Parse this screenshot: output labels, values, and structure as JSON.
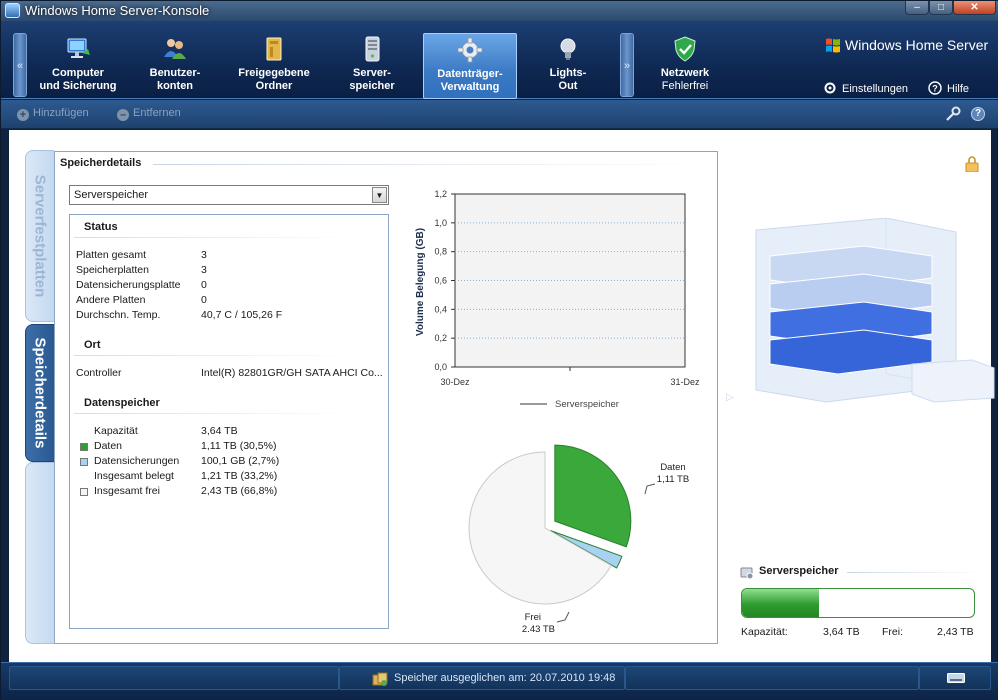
{
  "window": {
    "title": "Windows Home Server-Konsole",
    "min": "–",
    "max": "□",
    "close": "✕"
  },
  "nav": {
    "scroll_left": "«",
    "scroll_right": "»",
    "tabs": [
      {
        "line1": "Computer",
        "line2": "und Sicherung",
        "icon": "computer-icon"
      },
      {
        "line1": "Benutzer-",
        "line2": "konten",
        "icon": "users-icon"
      },
      {
        "line1": "Freigegebene",
        "line2": "Ordner",
        "icon": "folder-icon"
      },
      {
        "line1": "Server-",
        "line2": "speicher",
        "icon": "server-storage-icon"
      },
      {
        "line1": "Datenträger-",
        "line2": "Verwaltung",
        "icon": "gear-icon"
      },
      {
        "line1": "Lights-",
        "line2": "Out",
        "icon": "lightbulb-icon"
      }
    ],
    "network": {
      "line1": "Netzwerk",
      "line2": "Fehlerfrei",
      "icon": "shield-check-icon"
    },
    "brand": "Windows Home Server",
    "settings": "Einstellungen",
    "help": "Hilfe"
  },
  "actions": {
    "add": "Hinzufügen",
    "remove": "Entfernen"
  },
  "sidetabs": {
    "tab1": "Serverfestplatten",
    "tab2": "Speicherdetails"
  },
  "panel": {
    "title": "Speicherdetails",
    "dropdown": {
      "selected": "Serverspeicher"
    },
    "status": {
      "title": "Status",
      "rows": [
        {
          "label": "Platten gesamt",
          "value": "3"
        },
        {
          "label": "Speicherplatten",
          "value": "3"
        },
        {
          "label": "Datensicherungsplatte",
          "value": "0"
        },
        {
          "label": "Andere Platten",
          "value": "0"
        },
        {
          "label": "Durchschn. Temp.",
          "value": "40,7 C / 105,26 F"
        }
      ]
    },
    "ort": {
      "title": "Ort",
      "rows": [
        {
          "label": "Controller",
          "value": "Intel(R) 82801GR/GH SATA AHCI Co..."
        }
      ]
    },
    "storage": {
      "title": "Datenspeicher",
      "rows": [
        {
          "label": "Kapazität",
          "value": "3,64 TB",
          "swatch": ""
        },
        {
          "label": "Daten",
          "value": "1,11 TB (30,5%)",
          "swatch": "#2f9f2f"
        },
        {
          "label": "Datensicherungen",
          "value": "100,1 GB (2,7%)",
          "swatch": "#a8d2f2"
        },
        {
          "label": "Insgesamt belegt",
          "value": "1,21 TB (33,2%)",
          "swatch": ""
        },
        {
          "label": "Insgesamt frei",
          "value": "2,43 TB (66,8%)",
          "swatch": "#f4f4f4"
        }
      ]
    }
  },
  "chart_data": [
    {
      "type": "line",
      "ylabel": "Volume Belegung (GB)",
      "ylim": [
        0,
        1.2
      ],
      "yticks": [
        "0,0",
        "0,2",
        "0,4",
        "0,6",
        "0,8",
        "1,0",
        "1,2"
      ],
      "x": [
        "30-Dez",
        "31-Dez"
      ],
      "series": [
        {
          "name": "Serverspeicher",
          "values": []
        }
      ],
      "grid": true,
      "legend": "bottom"
    },
    {
      "type": "pie",
      "slices": [
        {
          "label": "Daten",
          "value_label": "1,11 TB",
          "percent": 30.5,
          "color": "#3aa83a"
        },
        {
          "label": "Datensicherungen",
          "value_label": "",
          "percent": 2.7,
          "color": "#a8d2f2"
        },
        {
          "label": "Frei",
          "value_label": "2,43 TB",
          "percent": 66.8,
          "color": "#f6f6f6"
        }
      ]
    }
  ],
  "server_storage": {
    "title": "Serverspeicher",
    "used_fraction": 0.332,
    "capacity_label": "Kapazität:",
    "capacity": "3,64 TB",
    "free_label": "Frei:",
    "free": "2,43 TB"
  },
  "status_bar": {
    "text": "Speicher ausgeglichen am: 20.07.2010 19:48"
  }
}
